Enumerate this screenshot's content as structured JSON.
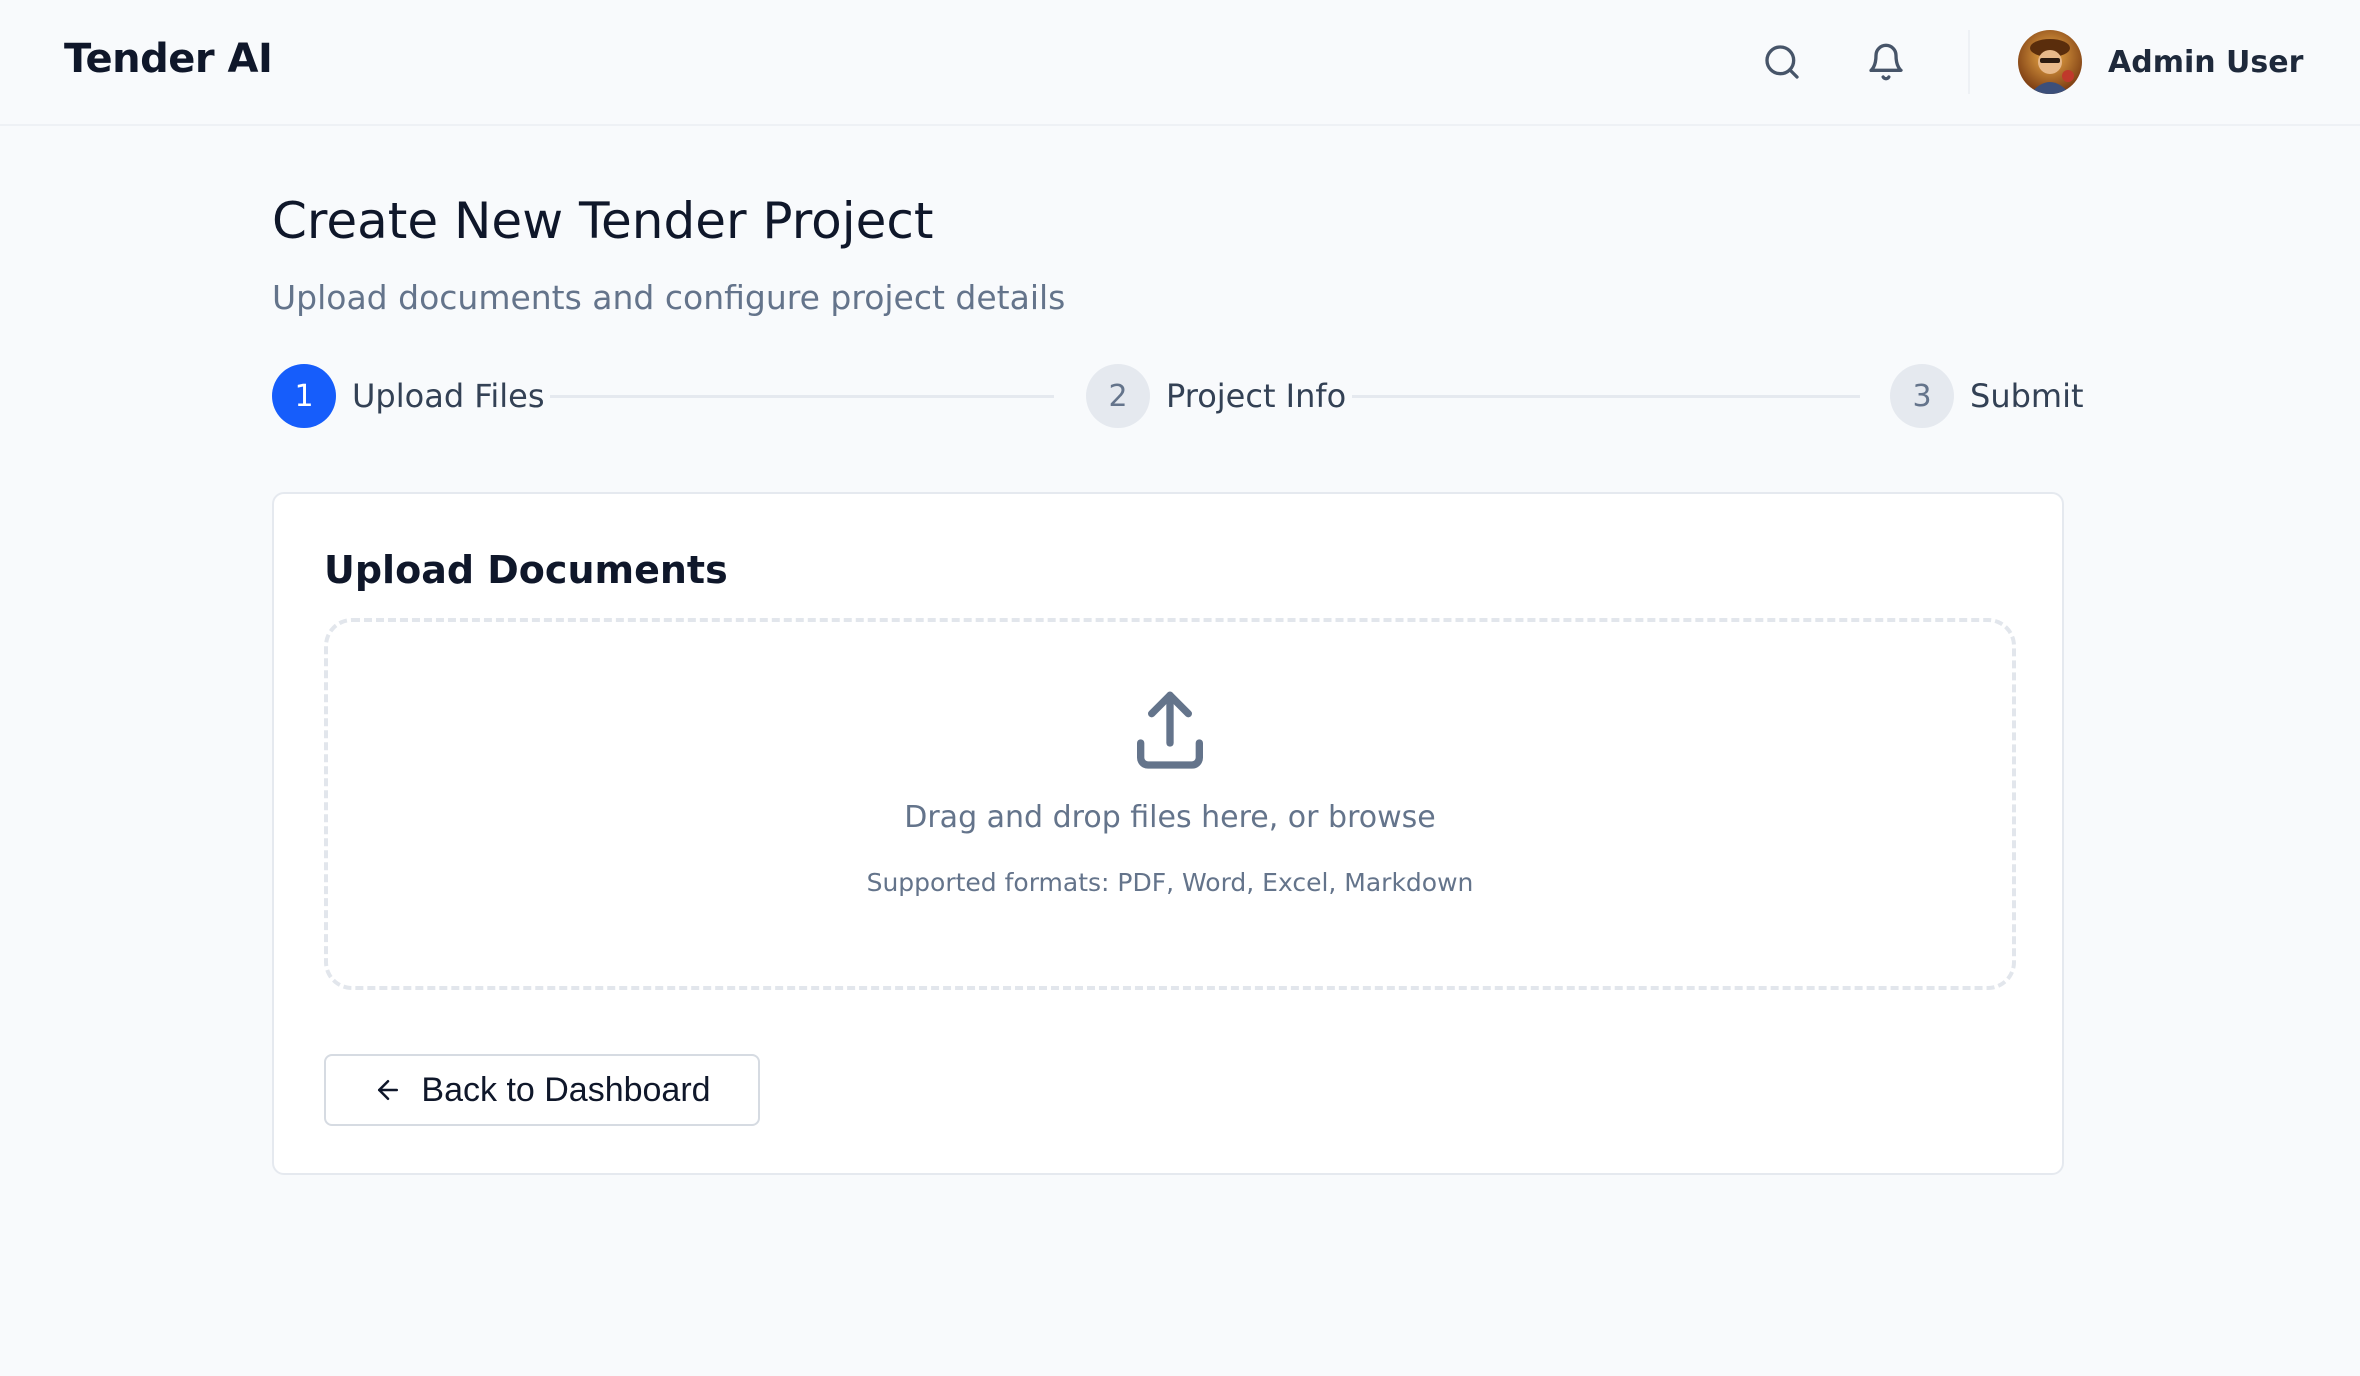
{
  "app": {
    "name": "Tender AI"
  },
  "header": {
    "icons": [
      "search-icon",
      "bell-icon"
    ],
    "user": {
      "name": "Admin User",
      "avatar": "avatar-image"
    }
  },
  "page": {
    "title": "Create New Tender Project",
    "subtitle": "Upload documents and configure project details"
  },
  "stepper": {
    "current": 1,
    "steps": [
      {
        "number": "1",
        "label": "Upload Files"
      },
      {
        "number": "2",
        "label": "Project Info"
      },
      {
        "number": "3",
        "label": "Submit"
      }
    ]
  },
  "upload_card": {
    "title": "Upload Documents",
    "icon": "upload-icon",
    "drop_text": "Drag and drop files here, or browse",
    "formats_text": "Supported formats: PDF, Word, Excel, Markdown",
    "back_button": {
      "label": "Back to Dashboard",
      "icon": "arrow-left-icon"
    }
  },
  "colors": {
    "accent": "#165dfb",
    "background": "#f8fafc",
    "muted_text": "#64748b",
    "border": "#e5e9ef"
  }
}
